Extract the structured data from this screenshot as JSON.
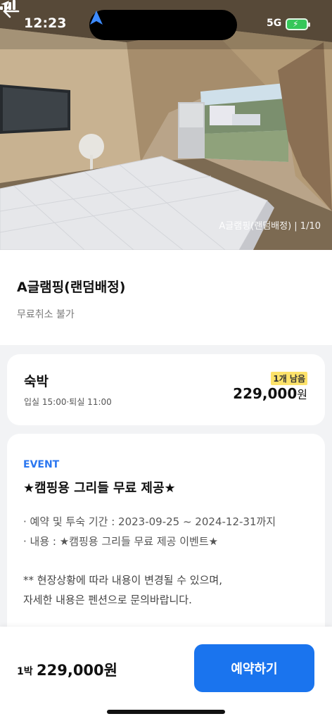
{
  "status_bar": {
    "time": "12:23",
    "network": "5G",
    "battery_color": "#35c759"
  },
  "hero": {
    "photo_counter": "A글램핑(랜덤배정) | 1/10",
    "back_icon": "back-arrow-icon"
  },
  "room": {
    "title": "A글램핑(랜덤배정)",
    "cancel_note": "무료취소 불가"
  },
  "stay": {
    "title": "숙박",
    "times": "입실 15:00·퇴실 11:00",
    "remaining": "1개 남음",
    "price": "229,000",
    "price_unit": "원"
  },
  "event": {
    "tag": "EVENT",
    "title": "★캠핑용 그리들 무료 제공★",
    "period": "· 예약 및 투숙 기간 : 2023-09-25 ~ 2024-12-31까지",
    "content": "· 내용 : ★캠핑용 그리들 무료 제공 이벤트★",
    "note_line1": "** 현장상황에 따라 내용이 변경될 수 있으며,",
    "note_line2": "자세한 내용은 펜션으로 문의바랍니다."
  },
  "bottom_bar": {
    "nights": "1박",
    "total_price": "229,000원",
    "book_label": "예약하기"
  },
  "colors": {
    "accent": "#1a74ee",
    "event_tag": "#2b77f0",
    "badge": "#fde26a"
  }
}
